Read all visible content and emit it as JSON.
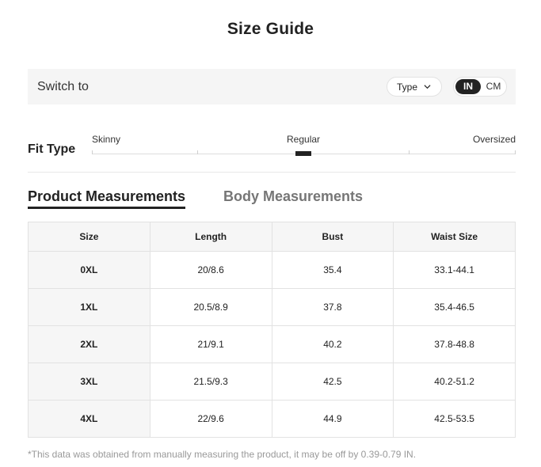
{
  "title": "Size Guide",
  "switch_bar": {
    "label": "Switch to",
    "type_select": {
      "value": "Type"
    },
    "units": [
      "IN",
      "CM"
    ],
    "selected_unit": "IN"
  },
  "fit_type": {
    "label": "Fit Type",
    "options": [
      "Skinny",
      "Regular",
      "Oversized"
    ],
    "selected": "Regular"
  },
  "tabs": [
    {
      "label": "Product Measurements",
      "active": true
    },
    {
      "label": "Body Measurements",
      "active": false
    }
  ],
  "table": {
    "headers": [
      "Size",
      "Length",
      "Bust",
      "Waist Size"
    ],
    "rows": [
      [
        "0XL",
        "20/8.6",
        "35.4",
        "33.1-44.1"
      ],
      [
        "1XL",
        "20.5/8.9",
        "37.8",
        "35.4-46.5"
      ],
      [
        "2XL",
        "21/9.1",
        "40.2",
        "37.8-48.8"
      ],
      [
        "3XL",
        "21.5/9.3",
        "42.5",
        "40.2-51.2"
      ],
      [
        "4XL",
        "22/9.6",
        "44.9",
        "42.5-53.5"
      ]
    ]
  },
  "footnote": "*This data was obtained from manually measuring the product, it may be off by 0.39-0.79 IN.",
  "colors": {
    "accent": "#222222",
    "panel_bg": "#f5f5f5",
    "border": "#e2e2e2",
    "muted_text": "#999999",
    "inactive_tab": "#767676"
  }
}
